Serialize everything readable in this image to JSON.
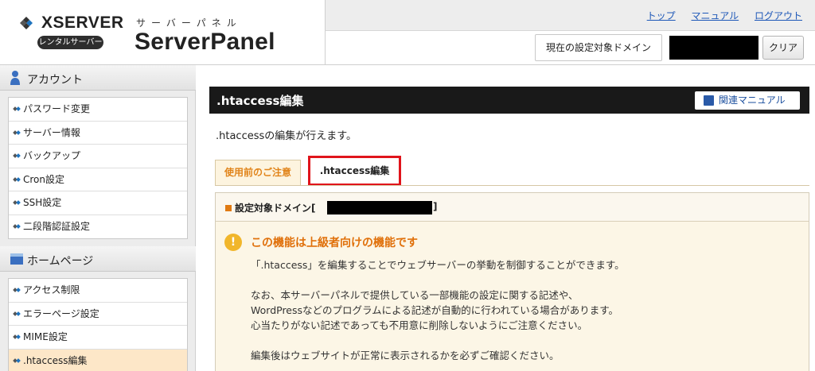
{
  "header": {
    "brand": "XSERVER",
    "brand_badge": "レンタルサーバー",
    "panel_sub": "サーバーパネル",
    "panel_title": "ServerPanel",
    "nav": [
      "トップ",
      "マニュアル",
      "ログアウト"
    ],
    "domain_label": "現在の設定対象ドメイン",
    "clear_button": "クリア"
  },
  "sidebar": {
    "sections": [
      {
        "title": "アカウント",
        "icon": "user-icon",
        "items": [
          "パスワード変更",
          "サーバー情報",
          "バックアップ",
          "Cron設定",
          "SSH設定",
          "二段階認証設定"
        ]
      },
      {
        "title": "ホームページ",
        "icon": "page-icon",
        "items": [
          "アクセス制限",
          "エラーページ設定",
          "MIME設定",
          ".htaccess編集"
        ]
      }
    ],
    "active_item": ".htaccess編集"
  },
  "main": {
    "title": ".htaccess編集",
    "manual_button": "関連マニュアル",
    "description": ".htaccessの編集が行えます。",
    "tabs": [
      "使用前のご注意",
      ".htaccess編集"
    ],
    "selected_tab": ".htaccess編集",
    "panel": {
      "domain_label": "設定対象ドメイン[",
      "domain_close": "]",
      "warning_title": "この機能は上級者向けの機能です",
      "paragraphs": [
        "「.htaccess」を編集することでウェブサーバーの挙動を制御することができます。",
        "なお、本サーバーパネルで提供している一部機能の設定に関する記述や、",
        "WordPressなどのプログラムによる記述が自動的に行われている場合があります。",
        "心当たりがない記述であっても不用意に削除しないようにご注意ください。",
        "編集後はウェブサイトが正常に表示されるかを必ずご確認ください。"
      ]
    }
  },
  "colors": {
    "link": "#1e58b8",
    "accent_orange": "#e0700a",
    "highlight_red": "#e0141b",
    "title_bar": "#191919"
  }
}
